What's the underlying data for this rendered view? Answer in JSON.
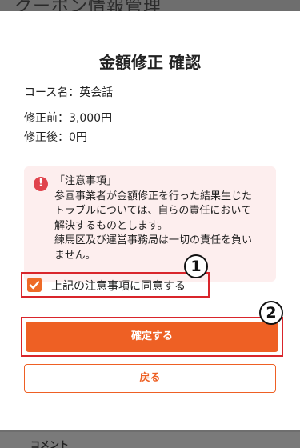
{
  "background": {
    "page_title": "クーポン情報管理",
    "footer_label": "コメント"
  },
  "modal": {
    "title": "金額修正 確認",
    "course": "コース名：英会話",
    "before": "修正前：3,000円",
    "after": "修正後：0円",
    "notice": {
      "icon": "alert-circle-icon",
      "lines": [
        "「注意事項」",
        "参画事業者が金額修正を行った結果生じた",
        "トラブルについては、自らの責任において",
        "解決するものとします。",
        "練馬区及び運営事務局は一切の責任を負い",
        "ません。"
      ]
    },
    "agree": {
      "checked": true,
      "label": "上記の注意事項に同意する"
    },
    "confirm_label": "確定する",
    "back_label": "戻る"
  },
  "annotations": {
    "badge_1": "1",
    "badge_2": "2"
  },
  "colors": {
    "accent": "#ee6024",
    "highlight_border": "#d9252b",
    "notice_bg": "#fdeeee",
    "alert_icon": "#e0434c"
  }
}
